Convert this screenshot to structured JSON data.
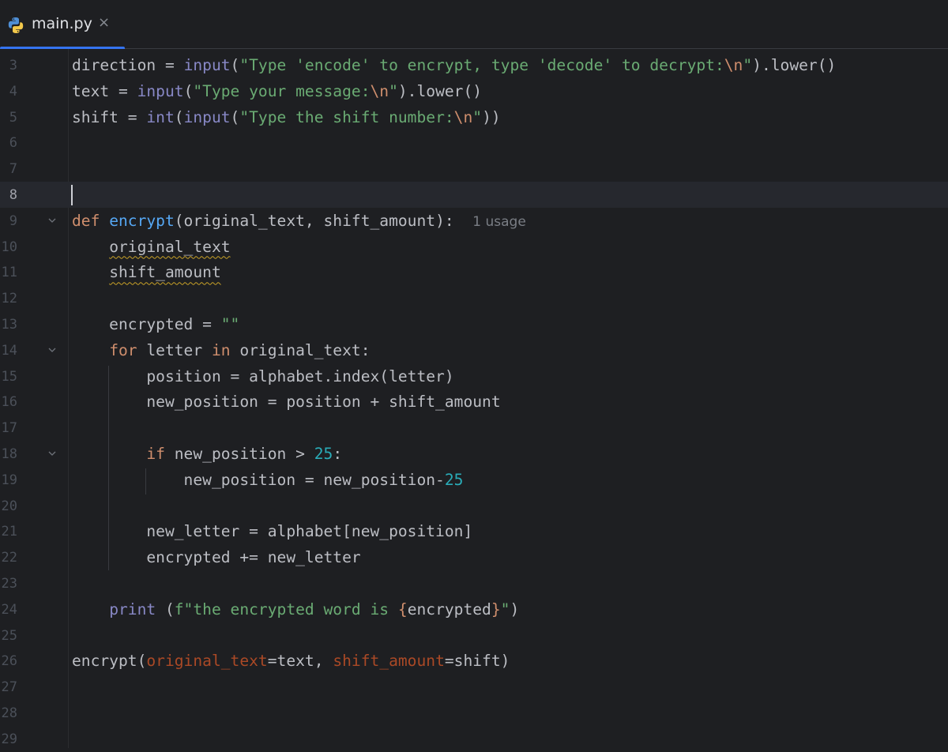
{
  "tab": {
    "filename": "main.py",
    "close_glyph": "×",
    "icon": "python-icon"
  },
  "editor": {
    "usage_hint": "1 usage",
    "lines": [
      {
        "n": "3",
        "tokens": [
          [
            "",
            "direction = "
          ],
          [
            "bi",
            "input"
          ],
          [
            "",
            "("
          ],
          [
            "str",
            "\"Type 'encode' to encrypt, type 'decode' to decrypt:"
          ],
          [
            "esc",
            "\\n"
          ],
          [
            "str",
            "\""
          ],
          [
            "",
            ").lower()"
          ]
        ]
      },
      {
        "n": "4",
        "tokens": [
          [
            "",
            "text = "
          ],
          [
            "bi",
            "input"
          ],
          [
            "",
            "("
          ],
          [
            "str",
            "\"Type your message:"
          ],
          [
            "esc",
            "\\n"
          ],
          [
            "str",
            "\""
          ],
          [
            "",
            ").lower()"
          ]
        ]
      },
      {
        "n": "5",
        "tokens": [
          [
            "",
            "shift = "
          ],
          [
            "bi",
            "int"
          ],
          [
            "",
            "("
          ],
          [
            "bi",
            "input"
          ],
          [
            "",
            "("
          ],
          [
            "str",
            "\"Type the shift number:"
          ],
          [
            "esc",
            "\\n"
          ],
          [
            "str",
            "\""
          ],
          [
            "",
            "))"
          ]
        ]
      },
      {
        "n": "6",
        "tokens": []
      },
      {
        "n": "7",
        "tokens": []
      },
      {
        "n": "8",
        "tokens": [],
        "current": true
      },
      {
        "n": "9",
        "tokens": [
          [
            "kw",
            "def "
          ],
          [
            "fn",
            "encrypt"
          ],
          [
            "",
            "(original_text, shift_amount):  "
          ],
          [
            "hint",
            "1 usage"
          ]
        ],
        "fold": true
      },
      {
        "n": "10",
        "tokens": [
          [
            "",
            "    "
          ],
          [
            "warn",
            "original_text"
          ]
        ]
      },
      {
        "n": "11",
        "tokens": [
          [
            "",
            "    "
          ],
          [
            "warn",
            "shift_amount"
          ]
        ]
      },
      {
        "n": "12",
        "tokens": []
      },
      {
        "n": "13",
        "tokens": [
          [
            "",
            "    encrypted = "
          ],
          [
            "str",
            "\"\""
          ]
        ]
      },
      {
        "n": "14",
        "tokens": [
          [
            "",
            "    "
          ],
          [
            "kw",
            "for "
          ],
          [
            "",
            "letter "
          ],
          [
            "kw",
            "in "
          ],
          [
            "",
            "original_text:"
          ]
        ],
        "fold": true
      },
      {
        "n": "15",
        "tokens": [
          [
            "",
            "        position = alphabet.index(letter)"
          ]
        ]
      },
      {
        "n": "16",
        "tokens": [
          [
            "",
            "        new_position = position + shift_amount"
          ]
        ]
      },
      {
        "n": "17",
        "tokens": []
      },
      {
        "n": "18",
        "tokens": [
          [
            "",
            "        "
          ],
          [
            "kw",
            "if "
          ],
          [
            "",
            "new_position > "
          ],
          [
            "num",
            "25"
          ],
          [
            "",
            ":"
          ]
        ],
        "fold": true
      },
      {
        "n": "19",
        "tokens": [
          [
            "",
            "            new_position = new_position-"
          ],
          [
            "num",
            "25"
          ]
        ]
      },
      {
        "n": "20",
        "tokens": []
      },
      {
        "n": "21",
        "tokens": [
          [
            "",
            "        new_letter = alphabet[new_position]"
          ]
        ]
      },
      {
        "n": "22",
        "tokens": [
          [
            "",
            "        encrypted += new_letter"
          ]
        ]
      },
      {
        "n": "23",
        "tokens": []
      },
      {
        "n": "24",
        "tokens": [
          [
            "",
            "    "
          ],
          [
            "bi",
            "print "
          ],
          [
            "",
            "("
          ],
          [
            "str",
            "f\"the encrypted word is "
          ],
          [
            "fbrace",
            "{"
          ],
          [
            "",
            "encrypted"
          ],
          [
            "fbrace",
            "}"
          ],
          [
            "str",
            "\""
          ],
          [
            "",
            ")"
          ]
        ]
      },
      {
        "n": "25",
        "tokens": []
      },
      {
        "n": "26",
        "tokens": [
          [
            "",
            "encrypt("
          ],
          [
            "param",
            "original_text"
          ],
          [
            "",
            "=text, "
          ],
          [
            "param",
            "shift_amount"
          ],
          [
            "",
            "=shift)"
          ]
        ]
      },
      {
        "n": "27",
        "tokens": []
      },
      {
        "n": "28",
        "tokens": []
      },
      {
        "n": "29",
        "tokens": []
      }
    ]
  },
  "colors": {
    "keyword": "#cf8e6d",
    "function": "#56a8f5",
    "builtin": "#8888c6",
    "string": "#6aab73",
    "number": "#2aacb8",
    "param": "#aa4926",
    "accent": "#3574f0"
  }
}
